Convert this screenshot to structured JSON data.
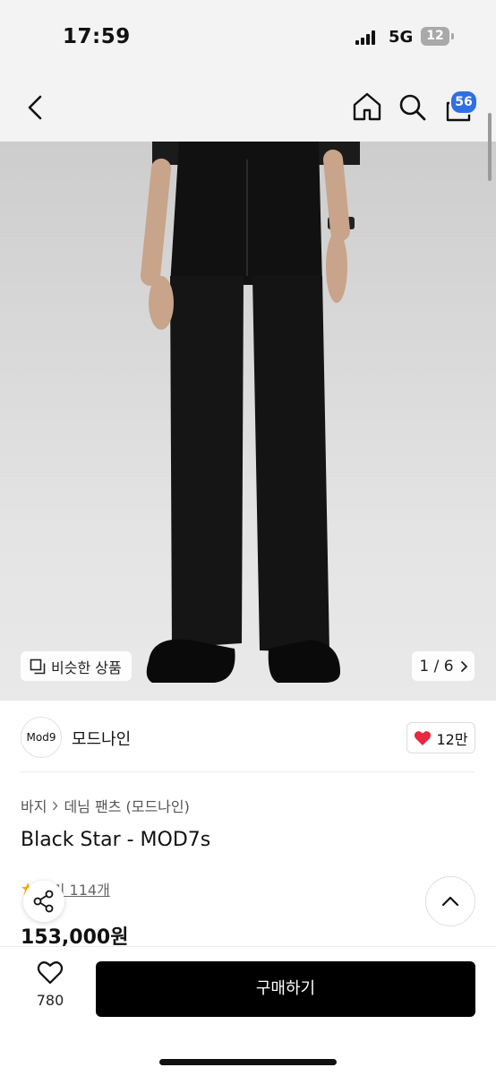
{
  "status_bar": {
    "time": "17:59",
    "network": "5G",
    "battery": "12"
  },
  "nav": {
    "back_icon": "chevron-left-icon",
    "home_icon": "home-icon",
    "search_icon": "search-icon",
    "cart_icon": "shopping-bag-icon",
    "cart_count": "56"
  },
  "gallery": {
    "similar_label": "비슷한 상품",
    "page_indicator": "1 / 6"
  },
  "brand": {
    "logo_text": "Mod9",
    "name": "모드나인",
    "likes": "12만"
  },
  "product": {
    "breadcrumb": [
      "바지",
      "데님 팬츠 (모드나인)"
    ],
    "title": "Black Star - MOD7s",
    "reviews": "후기 114개",
    "price": "153,000원"
  },
  "bottom_bar": {
    "wish_count": "780",
    "buy_label": "구매하기"
  },
  "colors": {
    "accent_badge": "#2f6fe4",
    "like_heart": "#e8283f",
    "buy_button": "#000000",
    "star": "#f5b301"
  }
}
